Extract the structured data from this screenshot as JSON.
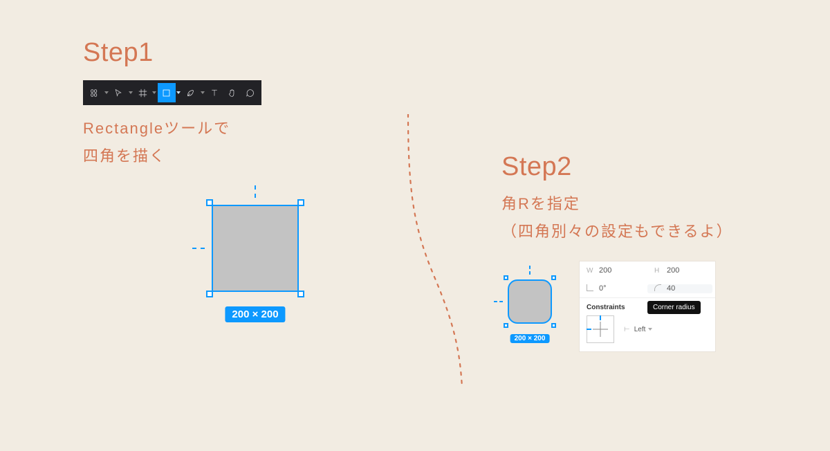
{
  "step1": {
    "title": "Step1",
    "desc_line1": "Rectangleツールで",
    "desc_line2": "四角を描く",
    "toolbar": {
      "tools": [
        {
          "name": "menu-icon",
          "active": false,
          "has_chev": true
        },
        {
          "name": "move-icon",
          "active": false,
          "has_chev": true
        },
        {
          "name": "frame-icon",
          "active": false,
          "has_chev": true
        },
        {
          "name": "rectangle-icon",
          "active": true,
          "has_chev": true
        },
        {
          "name": "pen-icon",
          "active": false,
          "has_chev": true
        },
        {
          "name": "text-icon",
          "active": false,
          "has_chev": false
        },
        {
          "name": "hand-icon",
          "active": false,
          "has_chev": false
        },
        {
          "name": "comment-icon",
          "active": false,
          "has_chev": false
        }
      ]
    },
    "rect_dimensions": "200 × 200"
  },
  "step2": {
    "title": "Step2",
    "desc_line1": "角Rを指定",
    "desc_line2": "（四角別々の設定もできるよ）",
    "rect_dimensions": "200 × 200",
    "panel": {
      "w_label": "W",
      "w_value": "200",
      "h_label": "H",
      "h_value": "200",
      "rot_label": "",
      "rot_value": "0°",
      "radius_value": "40",
      "tooltip": "Corner radius",
      "constraints_label": "Constraints",
      "constraint_value": "Left"
    }
  }
}
